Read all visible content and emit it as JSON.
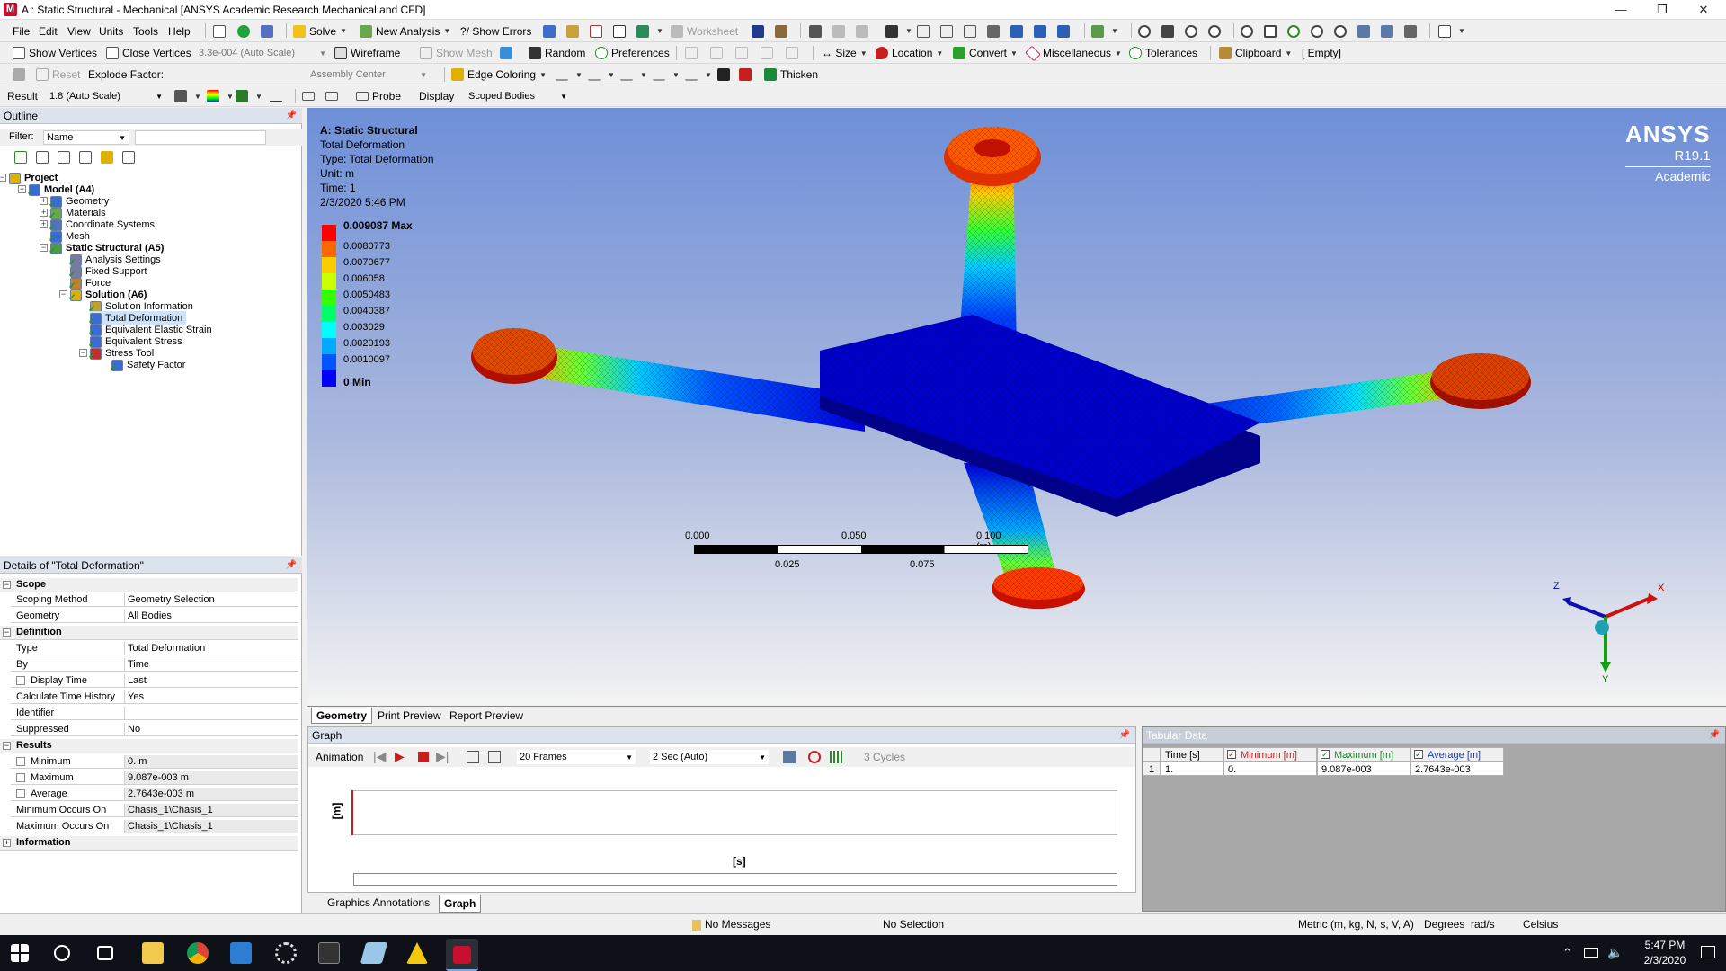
{
  "window": {
    "title": "A : Static Structural - Mechanical [ANSYS Academic Research Mechanical and CFD]",
    "app_icon_letter": "M",
    "min": "—",
    "max": "❐",
    "close": "✕"
  },
  "menu": [
    "File",
    "Edit",
    "View",
    "Units",
    "Tools",
    "Help"
  ],
  "toolbar1": {
    "solve": "Solve",
    "new_analysis": "New Analysis",
    "show_errors": "?/ Show Errors",
    "worksheet": "Worksheet"
  },
  "toolbar2": {
    "show_vertices": "Show Vertices",
    "close_vertices": "Close Vertices",
    "auto_scale": "3.3e-004 (Auto Scale)",
    "wireframe": "Wireframe",
    "show_mesh": "Show Mesh",
    "random": "Random",
    "preferences": "Preferences",
    "size": "Size",
    "location": "Location",
    "convert": "Convert",
    "miscellaneous": "Miscellaneous",
    "tolerances": "Tolerances",
    "clipboard": "Clipboard",
    "empty": "[ Empty]"
  },
  "toolbar3": {
    "reset": "Reset",
    "explode_factor": "Explode Factor:",
    "assembly_center": "Assembly Center",
    "edge_coloring": "Edge Coloring",
    "thicken": "Thicken"
  },
  "toolbar4": {
    "result_label": "Result",
    "result_scale": "1.8 (Auto Scale)",
    "probe": "Probe",
    "display_label": "Display",
    "display_value": "Scoped Bodies"
  },
  "outline": {
    "title": "Outline",
    "filter_label": "Filter:",
    "filter_value": "Name",
    "items": [
      {
        "label": "Project",
        "level": 0,
        "bold": true
      },
      {
        "label": "Model (A4)",
        "level": 1,
        "bold": true
      },
      {
        "label": "Geometry",
        "level": 2
      },
      {
        "label": "Materials",
        "level": 2
      },
      {
        "label": "Coordinate Systems",
        "level": 2
      },
      {
        "label": "Mesh",
        "level": 2
      },
      {
        "label": "Static Structural (A5)",
        "level": 2,
        "bold": true
      },
      {
        "label": "Analysis Settings",
        "level": 3
      },
      {
        "label": "Fixed Support",
        "level": 3
      },
      {
        "label": "Force",
        "level": 3
      },
      {
        "label": "Solution (A6)",
        "level": 3,
        "bold": true
      },
      {
        "label": "Solution Information",
        "level": 4
      },
      {
        "label": "Total Deformation",
        "level": 4,
        "selected": true
      },
      {
        "label": "Equivalent Elastic Strain",
        "level": 4
      },
      {
        "label": "Equivalent Stress",
        "level": 4
      },
      {
        "label": "Stress Tool",
        "level": 4
      },
      {
        "label": "Safety Factor",
        "level": 5
      }
    ]
  },
  "details": {
    "title": "Details of \"Total Deformation\"",
    "groups": {
      "scope": "Scope",
      "definition": "Definition",
      "results": "Results",
      "information": "Information"
    },
    "rows": [
      {
        "k": "Scoping Method",
        "v": "Geometry Selection"
      },
      {
        "k": "Geometry",
        "v": "All Bodies"
      },
      {
        "k": "Type",
        "v": "Total Deformation"
      },
      {
        "k": "By",
        "v": "Time"
      },
      {
        "k": "Display Time",
        "v": "Last"
      },
      {
        "k": "Calculate Time History",
        "v": "Yes"
      },
      {
        "k": "Identifier",
        "v": ""
      },
      {
        "k": "Suppressed",
        "v": "No"
      },
      {
        "k": "Minimum",
        "v": "0. m"
      },
      {
        "k": "Maximum",
        "v": "9.087e-003 m"
      },
      {
        "k": "Average",
        "v": "2.7643e-003 m"
      },
      {
        "k": "Minimum Occurs On",
        "v": "Chasis_1\\Chasis_1"
      },
      {
        "k": "Maximum Occurs On",
        "v": "Chasis_1\\Chasis_1"
      }
    ]
  },
  "overlay": {
    "analysis": "A: Static Structural",
    "result": "Total Deformation",
    "type": "Type: Total Deformation",
    "unit": "Unit: m",
    "time": "Time: 1",
    "date": "2/3/2020 5:46 PM"
  },
  "legend": {
    "labels": [
      "0.009087 Max",
      "0.0080773",
      "0.0070677",
      "0.006058",
      "0.0050483",
      "0.0040387",
      "0.003029",
      "0.0020193",
      "0.0010097",
      "0 Min"
    ],
    "colors": [
      "#ff0000",
      "#ff6600",
      "#ffcc00",
      "#ccff00",
      "#33ff00",
      "#00ff66",
      "#00ffff",
      "#00aaff",
      "#0055ff",
      "#0000ff"
    ]
  },
  "logo": {
    "brand": "ANSYS",
    "version": "R19.1",
    "edition": "Academic"
  },
  "scale_bar": {
    "top": [
      "0.000",
      "0.050",
      "0.100 (m)"
    ],
    "bottom": [
      "0.025",
      "0.075"
    ]
  },
  "triad": {
    "x": "X",
    "y": "Y",
    "z": "Z"
  },
  "view_tabs": [
    "Geometry",
    "Print Preview",
    "Report Preview"
  ],
  "graph": {
    "title": "Graph",
    "animation": "Animation",
    "frames": "20 Frames",
    "duration": "2 Sec (Auto)",
    "cycles": "3 Cycles",
    "yunit": "[m]",
    "xunit": "[s]"
  },
  "bottom_tabs": [
    "Graphics Annotations",
    "Graph"
  ],
  "tabular": {
    "title": "Tabular Data",
    "headers": [
      "Time [s]",
      "Minimum [m]",
      "Maximum [m]",
      "Average [m]"
    ],
    "row": [
      "1",
      "1.",
      "0.",
      "9.087e-003",
      "2.7643e-003"
    ]
  },
  "status": {
    "messages": "No Messages",
    "selection": "No Selection",
    "units": "Metric (m, kg, N, s, V, A)",
    "degrees": "Degrees",
    "rads": "rad/s",
    "temp": "Celsius"
  },
  "taskbar": {
    "time": "5:47 PM",
    "date": "2/3/2020"
  }
}
